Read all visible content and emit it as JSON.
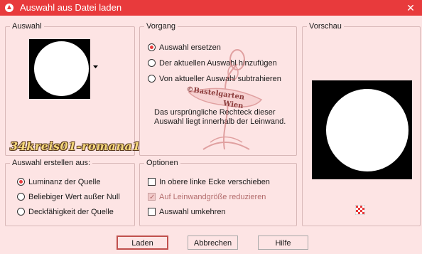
{
  "window": {
    "title": "Auswahl aus Datei laden",
    "close_glyph": "✕"
  },
  "auswahl": {
    "title": "Auswahl",
    "source_name": "34kreis01-romana1"
  },
  "vorgang": {
    "title": "Vorgang",
    "options": [
      {
        "label": "Auswahl ersetzen",
        "selected": true
      },
      {
        "label": "Der aktuellen Auswahl hinzufügen",
        "selected": false
      },
      {
        "label": "Von aktueller Auswahl subtrahieren",
        "selected": false
      }
    ],
    "description": "Das ursprüngliche Rechteck dieser Auswahl liegt innerhalb der Leinwand."
  },
  "vorschau": {
    "title": "Vorschau"
  },
  "auswahl_erstellen": {
    "title": "Auswahl erstellen aus:",
    "options": [
      {
        "label": "Luminanz der Quelle",
        "selected": true
      },
      {
        "label": "Beliebiger Wert außer Null",
        "selected": false
      },
      {
        "label": "Deckfähigkeit der Quelle",
        "selected": false
      }
    ]
  },
  "optionen": {
    "title": "Optionen",
    "checks": [
      {
        "label": "In obere linke Ecke verschieben",
        "checked": false,
        "disabled": false
      },
      {
        "label": "Auf Leinwandgröße reduzieren",
        "checked": true,
        "disabled": true
      },
      {
        "label": "Auswahl umkehren",
        "checked": false,
        "disabled": false
      }
    ]
  },
  "watermark": {
    "line1": "©Bastelgarten",
    "line2": "Wien"
  },
  "buttons": {
    "laden": "Laden",
    "abbrechen": "Abbrechen",
    "hilfe": "Hilfe"
  },
  "colors": {
    "titlebar": "#e83a3c",
    "background": "#fde4e4",
    "accent": "#e83a3c"
  }
}
